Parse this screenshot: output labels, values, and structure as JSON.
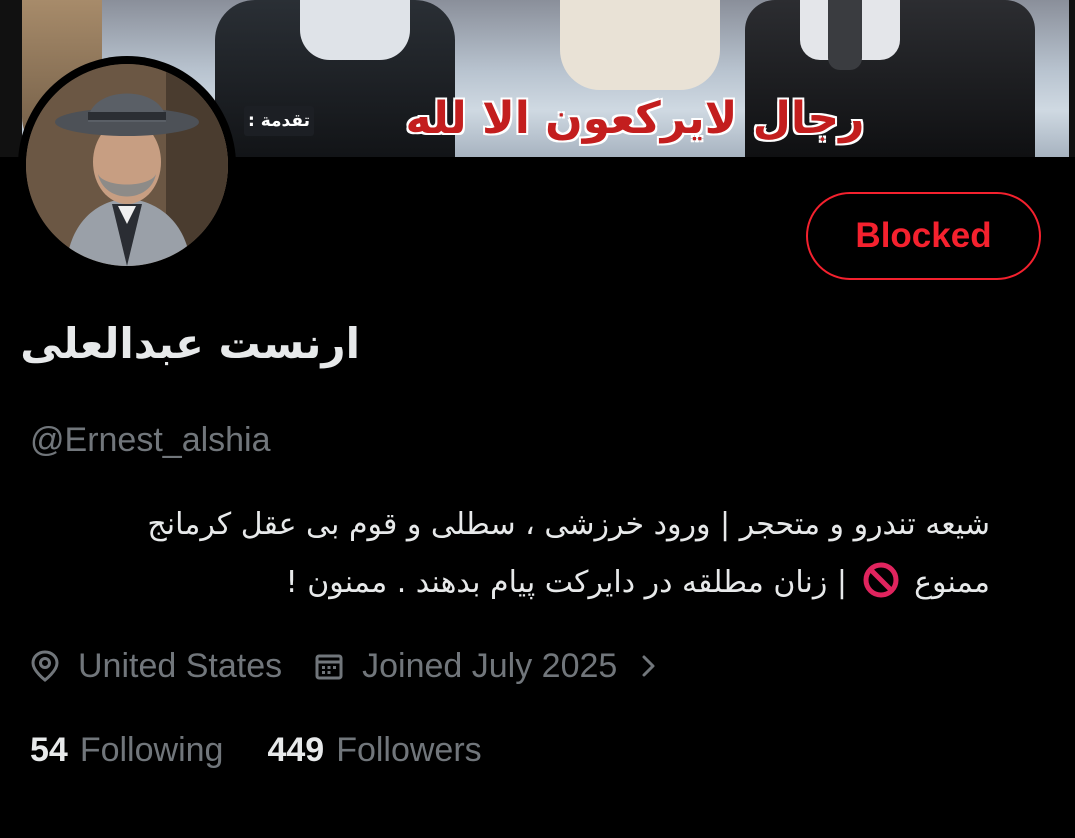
{
  "banner": {
    "caption": "رجال لايركعون الا لله",
    "caption_small": "تقدمة :"
  },
  "profile": {
    "display_name": "ارنست عبدالعلی",
    "handle": "@Ernest_alshia",
    "blocked_label": "Blocked",
    "bio_line1": "شیعه تندرو و متحجر | ورود خرزشی ، سطلی و قوم بی عقل کرمانج",
    "bio_line2_a": "ممنوع",
    "bio_line2_b": "| زنان مطلقه در دایرکت پیام بدهند . ممنون !",
    "location": "United States",
    "joined": "Joined July 2025"
  },
  "stats": {
    "following_count": "54",
    "following_label": "Following",
    "followers_count": "449",
    "followers_label": "Followers"
  },
  "colors": {
    "background": "#000000",
    "text_primary": "#e7e9ea",
    "text_secondary": "#71767b",
    "blocked_red": "#f4212e"
  },
  "icons": {
    "location": "location-pin-icon",
    "calendar": "calendar-icon",
    "chevron": "chevron-right-icon",
    "no_entry": "no-entry-emoji-icon"
  }
}
